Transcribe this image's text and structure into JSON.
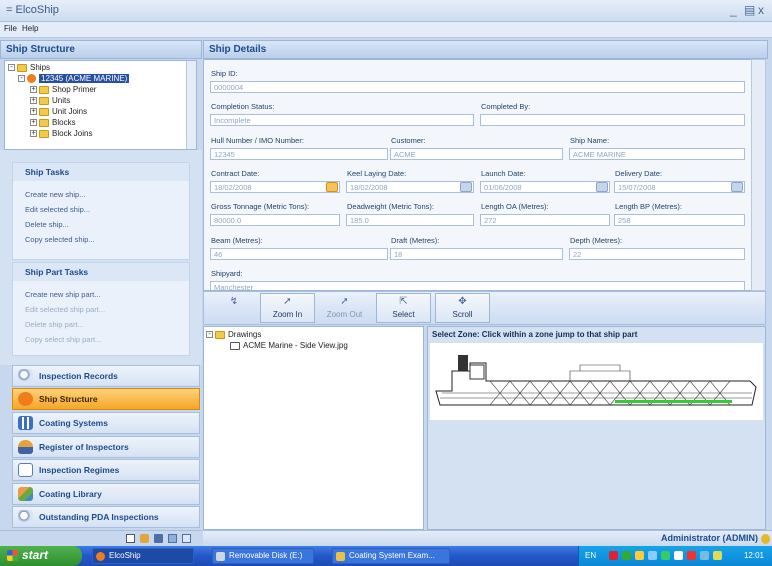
{
  "window": {
    "title": "ElcoShip"
  },
  "menu": {
    "file": "File",
    "help": "Help"
  },
  "left": {
    "header": "Ship Structure",
    "tree": [
      {
        "label": "Ships",
        "level": 0,
        "icon": "folder"
      },
      {
        "label": "12345 (ACME MARINE)",
        "level": 1,
        "icon": "ship",
        "selected": true
      },
      {
        "label": "Shop Primer",
        "level": 2,
        "icon": "part"
      },
      {
        "label": "Units",
        "level": 2,
        "icon": "part"
      },
      {
        "label": "Unit Joins",
        "level": 2,
        "icon": "part"
      },
      {
        "label": "Blocks",
        "level": 2,
        "icon": "part"
      },
      {
        "label": "Block Joins",
        "level": 2,
        "icon": "part"
      }
    ],
    "ship_tasks": {
      "title": "Ship Tasks",
      "links": [
        "Create new ship...",
        "Edit selected ship...",
        "Delete ship...",
        "Copy selected ship..."
      ]
    },
    "ship_part_tasks": {
      "title": "Ship Part Tasks",
      "links": [
        "Create new ship part...",
        "Edit selected ship part...",
        "Delete ship part...",
        "Copy select ship part..."
      ]
    },
    "nav": [
      {
        "label": "Inspection Records",
        "icon": "magnifier-icon"
      },
      {
        "label": "Ship Structure",
        "icon": "ship-structure-icon",
        "active": true
      },
      {
        "label": "Coating Systems",
        "icon": "grid-icon"
      },
      {
        "label": "Register of Inspectors",
        "icon": "inspector-icon"
      },
      {
        "label": "Inspection Regimes",
        "icon": "document-icon"
      },
      {
        "label": "Coating Library",
        "icon": "library-icon"
      },
      {
        "label": "Outstanding PDA Inspections",
        "icon": "pda-icon"
      }
    ]
  },
  "details": {
    "header": "Ship Details",
    "ship_id": {
      "label": "Ship ID:",
      "value": "0000004"
    },
    "completion_status": {
      "label": "Completion Status:",
      "value": "Incomplete"
    },
    "completed_by": {
      "label": "Completed By:",
      "value": ""
    },
    "hull_number": {
      "label": "Hull Number / IMO Number:",
      "value": "12345"
    },
    "customer": {
      "label": "Customer:",
      "value": "ACME"
    },
    "ship_name": {
      "label": "Ship Name:",
      "value": "ACME MARINE"
    },
    "contract_date": {
      "label": "Contract Date:",
      "value": "18/02/2008"
    },
    "keel_laying_date": {
      "label": "Keel Laying Date:",
      "value": "18/02/2008"
    },
    "launch_date": {
      "label": "Launch Date:",
      "value": "01/06/2008"
    },
    "delivery_date": {
      "label": "Delivery Date:",
      "value": "15/07/2008"
    },
    "gross_tonnage": {
      "label": "Gross Tonnage (Metric Tons):",
      "value": "80000.0"
    },
    "deadweight": {
      "label": "Deadweight (Metric Tons):",
      "value": "185.0"
    },
    "length_oa": {
      "label": "Length OA (Metres):",
      "value": "272"
    },
    "length_bp": {
      "label": "Length BP (Metres):",
      "value": "258"
    },
    "beam": {
      "label": "Beam (Metres):",
      "value": "46"
    },
    "draft": {
      "label": "Draft (Metres):",
      "value": "18"
    },
    "depth": {
      "label": "Depth (Metres):",
      "value": "22"
    },
    "shipyard": {
      "label": "Shipyard:",
      "value": "Manchester"
    }
  },
  "toolbar": {
    "zoom_in": "Zoom In",
    "zoom_out": "Zoom Out",
    "select": "Select",
    "scroll": "Scroll"
  },
  "drawings": {
    "root": "Drawings",
    "file": "ACME Marine - Side View.jpg"
  },
  "zone": {
    "title": "Select Zone: Click within a zone jump to that ship part"
  },
  "status": {
    "user": "Administrator (ADMIN)"
  },
  "taskbar": {
    "start": "start",
    "items": [
      "ElcoShip",
      "Removable Disk (E:)",
      "Coating System Exam..."
    ],
    "lang": "EN",
    "clock": "12:01"
  }
}
